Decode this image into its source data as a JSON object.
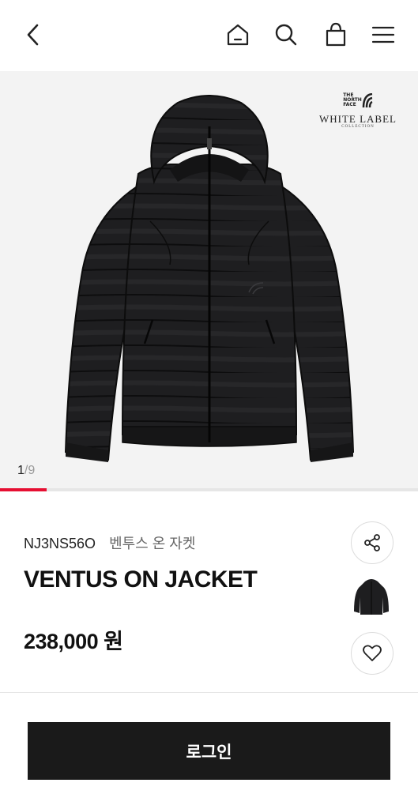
{
  "header": {
    "icons": [
      "back-icon",
      "home-icon",
      "search-icon",
      "bag-icon",
      "menu-icon"
    ]
  },
  "gallery": {
    "brand": {
      "logo_lines": [
        "THE",
        "NORTH",
        "FACE"
      ],
      "title": "WHITE LABEL",
      "subtitle": "COLLECTION"
    },
    "counter_current": "1",
    "counter_total": "/9",
    "progress": 0.111
  },
  "product": {
    "code": "NJ3NS56O",
    "korean_name": "벤투스 온 자켓",
    "title": "VENTUS ON JACKET",
    "price": "238,000 원"
  },
  "actions": {
    "icons": [
      "share-icon",
      "heart-icon"
    ]
  },
  "footer": {
    "login_label": "로그인"
  },
  "colors": {
    "accent": "#e60f32",
    "button_bg": "#1a1a1a",
    "gallery_bg": "#f3f3f3"
  }
}
